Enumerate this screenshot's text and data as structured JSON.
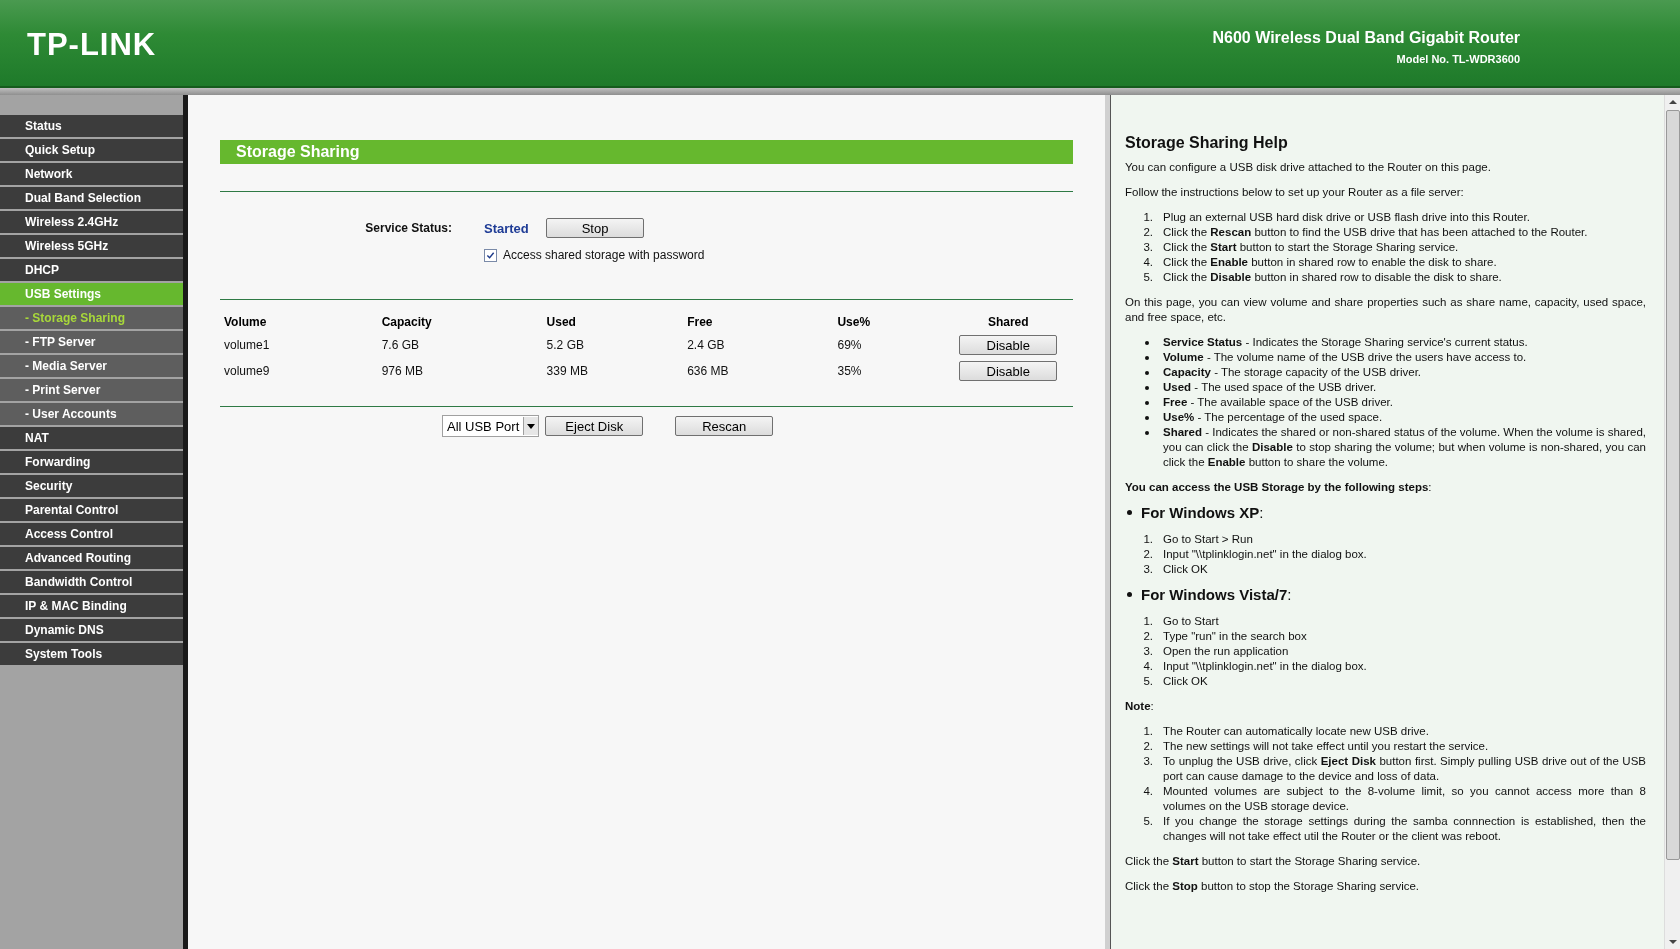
{
  "header": {
    "logo": "TP-LINK",
    "product": "N600 Wireless Dual Band Gigabit Router",
    "model": "Model No. TL-WDR3600"
  },
  "sidebar": {
    "items": [
      {
        "label": "Status",
        "kind": "main",
        "selected": false
      },
      {
        "label": "Quick Setup",
        "kind": "main",
        "selected": false
      },
      {
        "label": "Network",
        "kind": "main",
        "selected": false
      },
      {
        "label": "Dual Band Selection",
        "kind": "main",
        "selected": false
      },
      {
        "label": "Wireless 2.4GHz",
        "kind": "main",
        "selected": false
      },
      {
        "label": "Wireless 5GHz",
        "kind": "main",
        "selected": false
      },
      {
        "label": "DHCP",
        "kind": "main",
        "selected": false
      },
      {
        "label": "USB Settings",
        "kind": "main",
        "selected": true
      },
      {
        "label": "- Storage Sharing",
        "kind": "sub",
        "selected": true
      },
      {
        "label": "- FTP Server",
        "kind": "sub",
        "selected": false
      },
      {
        "label": "- Media Server",
        "kind": "sub",
        "selected": false
      },
      {
        "label": "- Print Server",
        "kind": "sub",
        "selected": false
      },
      {
        "label": "- User Accounts",
        "kind": "sub",
        "selected": false
      },
      {
        "label": "NAT",
        "kind": "main",
        "selected": false
      },
      {
        "label": "Forwarding",
        "kind": "main",
        "selected": false
      },
      {
        "label": "Security",
        "kind": "main",
        "selected": false
      },
      {
        "label": "Parental Control",
        "kind": "main",
        "selected": false
      },
      {
        "label": "Access Control",
        "kind": "main",
        "selected": false
      },
      {
        "label": "Advanced Routing",
        "kind": "main",
        "selected": false
      },
      {
        "label": "Bandwidth Control",
        "kind": "main",
        "selected": false
      },
      {
        "label": "IP & MAC Binding",
        "kind": "main",
        "selected": false
      },
      {
        "label": "Dynamic DNS",
        "kind": "main",
        "selected": false
      },
      {
        "label": "System Tools",
        "kind": "main",
        "selected": false
      }
    ]
  },
  "main": {
    "title": "Storage Sharing",
    "service": {
      "label": "Service Status:",
      "value": "Started",
      "button": "Stop"
    },
    "password": {
      "label": "Access shared storage with password",
      "checked": true
    },
    "table": {
      "columns": [
        "Volume",
        "Capacity",
        "Used",
        "Free",
        "Use%",
        "Shared"
      ],
      "rows": [
        {
          "cells": [
            "volume1",
            "7.6 GB",
            "5.2 GB",
            "2.4 GB",
            "69%"
          ],
          "button": "Disable"
        },
        {
          "cells": [
            "volume9",
            "976 MB",
            "339 MB",
            "636 MB",
            "35%"
          ],
          "button": "Disable"
        }
      ]
    },
    "port_select": {
      "value": "All USB Port"
    },
    "buttons": [
      "Eject Disk",
      "Rescan"
    ]
  },
  "help": {
    "title": "Storage Sharing Help",
    "blocks": [
      {
        "kind": "p",
        "text": "You can configure a USB disk drive attached to the Router on this page."
      },
      {
        "kind": "p",
        "text": "Follow the instructions below to set up your Router as a file server:"
      },
      {
        "kind": "ol",
        "items": [
          {
            "n": "1.",
            "text": "Plug an external USB hard disk drive or USB flash drive into this Router."
          },
          {
            "n": "2.",
            "text": "Click the **Rescan** button to find the USB drive that has been attached to the Router."
          },
          {
            "n": "3.",
            "text": "Click the **Start** button to start the Storage Sharing service."
          },
          {
            "n": "4.",
            "text": "Click the **Enable** button in shared row to enable the disk to share."
          },
          {
            "n": "5.",
            "text": "Click the **Disable** button in shared row to disable the disk to share."
          }
        ]
      },
      {
        "kind": "p",
        "text": "On this page, you can view volume and share properties such as share name, capacity, used space, and free space, etc."
      },
      {
        "kind": "ul",
        "items": [
          {
            "text": "**Service Status** - Indicates the Storage Sharing service's current status."
          },
          {
            "text": "**Volume** - The volume name of the USB drive the users have access to."
          },
          {
            "text": "**Capacity** - The storage capacity of the USB driver."
          },
          {
            "text": "**Used** - The used space of the USB driver."
          },
          {
            "text": "**Free** - The available space of the USB driver."
          },
          {
            "text": "**Use%** - The percentage of the used space."
          },
          {
            "text": "**Shared** - Indicates the shared or non-shared status of the volume. When the volume is shared, you can click the **Disable** to stop sharing the volume; but when volume is non-shared, you can click the **Enable** button to share the volume."
          }
        ]
      },
      {
        "kind": "p",
        "text": "**You can access the USB Storage by the following steps**:"
      },
      {
        "kind": "section",
        "text": "**For Windows XP**:"
      },
      {
        "kind": "ol",
        "items": [
          {
            "n": "1.",
            "text": "Go to Start > Run"
          },
          {
            "n": "2.",
            "text": "Input \"\\\\tplinklogin.net\" in the dialog box."
          },
          {
            "n": "3.",
            "text": "Click OK"
          }
        ]
      },
      {
        "kind": "section",
        "text": "**For Windows Vista/7**:"
      },
      {
        "kind": "ol",
        "items": [
          {
            "n": "1.",
            "text": "Go to Start"
          },
          {
            "n": "2.",
            "text": "Type \"run\" in the search box"
          },
          {
            "n": "3.",
            "text": "Open the run application"
          },
          {
            "n": "4.",
            "text": "Input \"\\\\tplinklogin.net\" in the dialog box."
          },
          {
            "n": "5.",
            "text": "Click OK"
          }
        ]
      },
      {
        "kind": "p",
        "text": "**Note**:"
      },
      {
        "kind": "ol",
        "items": [
          {
            "n": "1.",
            "text": "The Router can automatically locate new USB drive."
          },
          {
            "n": "2.",
            "text": "The new settings will not take effect until you restart the service."
          },
          {
            "n": "3.",
            "text": "To unplug the USB drive, click **Eject Disk** button first. Simply pulling USB drive out of the USB port can cause damage to the device and loss of data."
          },
          {
            "n": "4.",
            "text": "Mounted volumes are subject to the 8-volume limit, so you cannot access more than 8 volumes on the USB storage device."
          },
          {
            "n": "5.",
            "text": "If you change the storage settings during the samba connnection is established, then the changes will not take effect util the Router or the client was reboot."
          }
        ]
      },
      {
        "kind": "p",
        "text": "Click the **Start** button to start the Storage Sharing service."
      },
      {
        "kind": "p",
        "text": "Click the **Stop** button to stop the Storage Sharing service."
      }
    ]
  }
}
